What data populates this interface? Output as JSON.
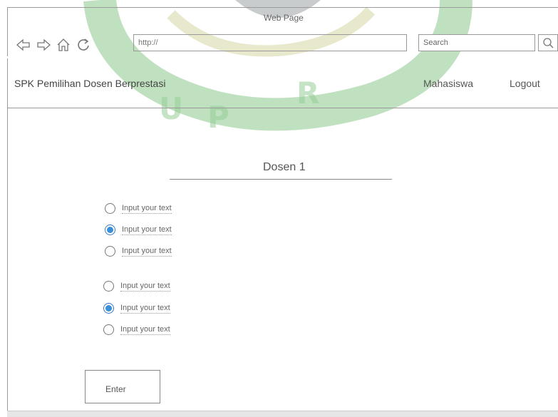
{
  "browser": {
    "window_title": "Web Page",
    "url": "http://",
    "search_placeholder": "Search"
  },
  "app": {
    "title": "SPK Pemilihan Dosen Berprestasi",
    "menu": [
      "Mahasiswa",
      "Logout"
    ]
  },
  "watermark": {
    "letters": [
      "U",
      "P",
      "R"
    ]
  },
  "form": {
    "section_title": "Dosen 1",
    "group1": [
      {
        "label": "Input your text",
        "checked": false
      },
      {
        "label": "Input your text",
        "checked": true
      },
      {
        "label": "Input your text",
        "checked": false
      }
    ],
    "group2": [
      {
        "label": "Input your text",
        "checked": false
      },
      {
        "label": "Input your text",
        "checked": true
      },
      {
        "label": "Input your text",
        "checked": false
      }
    ],
    "submit_label": "Enter"
  },
  "colors": {
    "watermark_green": "#8fcd8f",
    "radio_selected": "#3a8fd9",
    "border": "#9a9a9a"
  }
}
